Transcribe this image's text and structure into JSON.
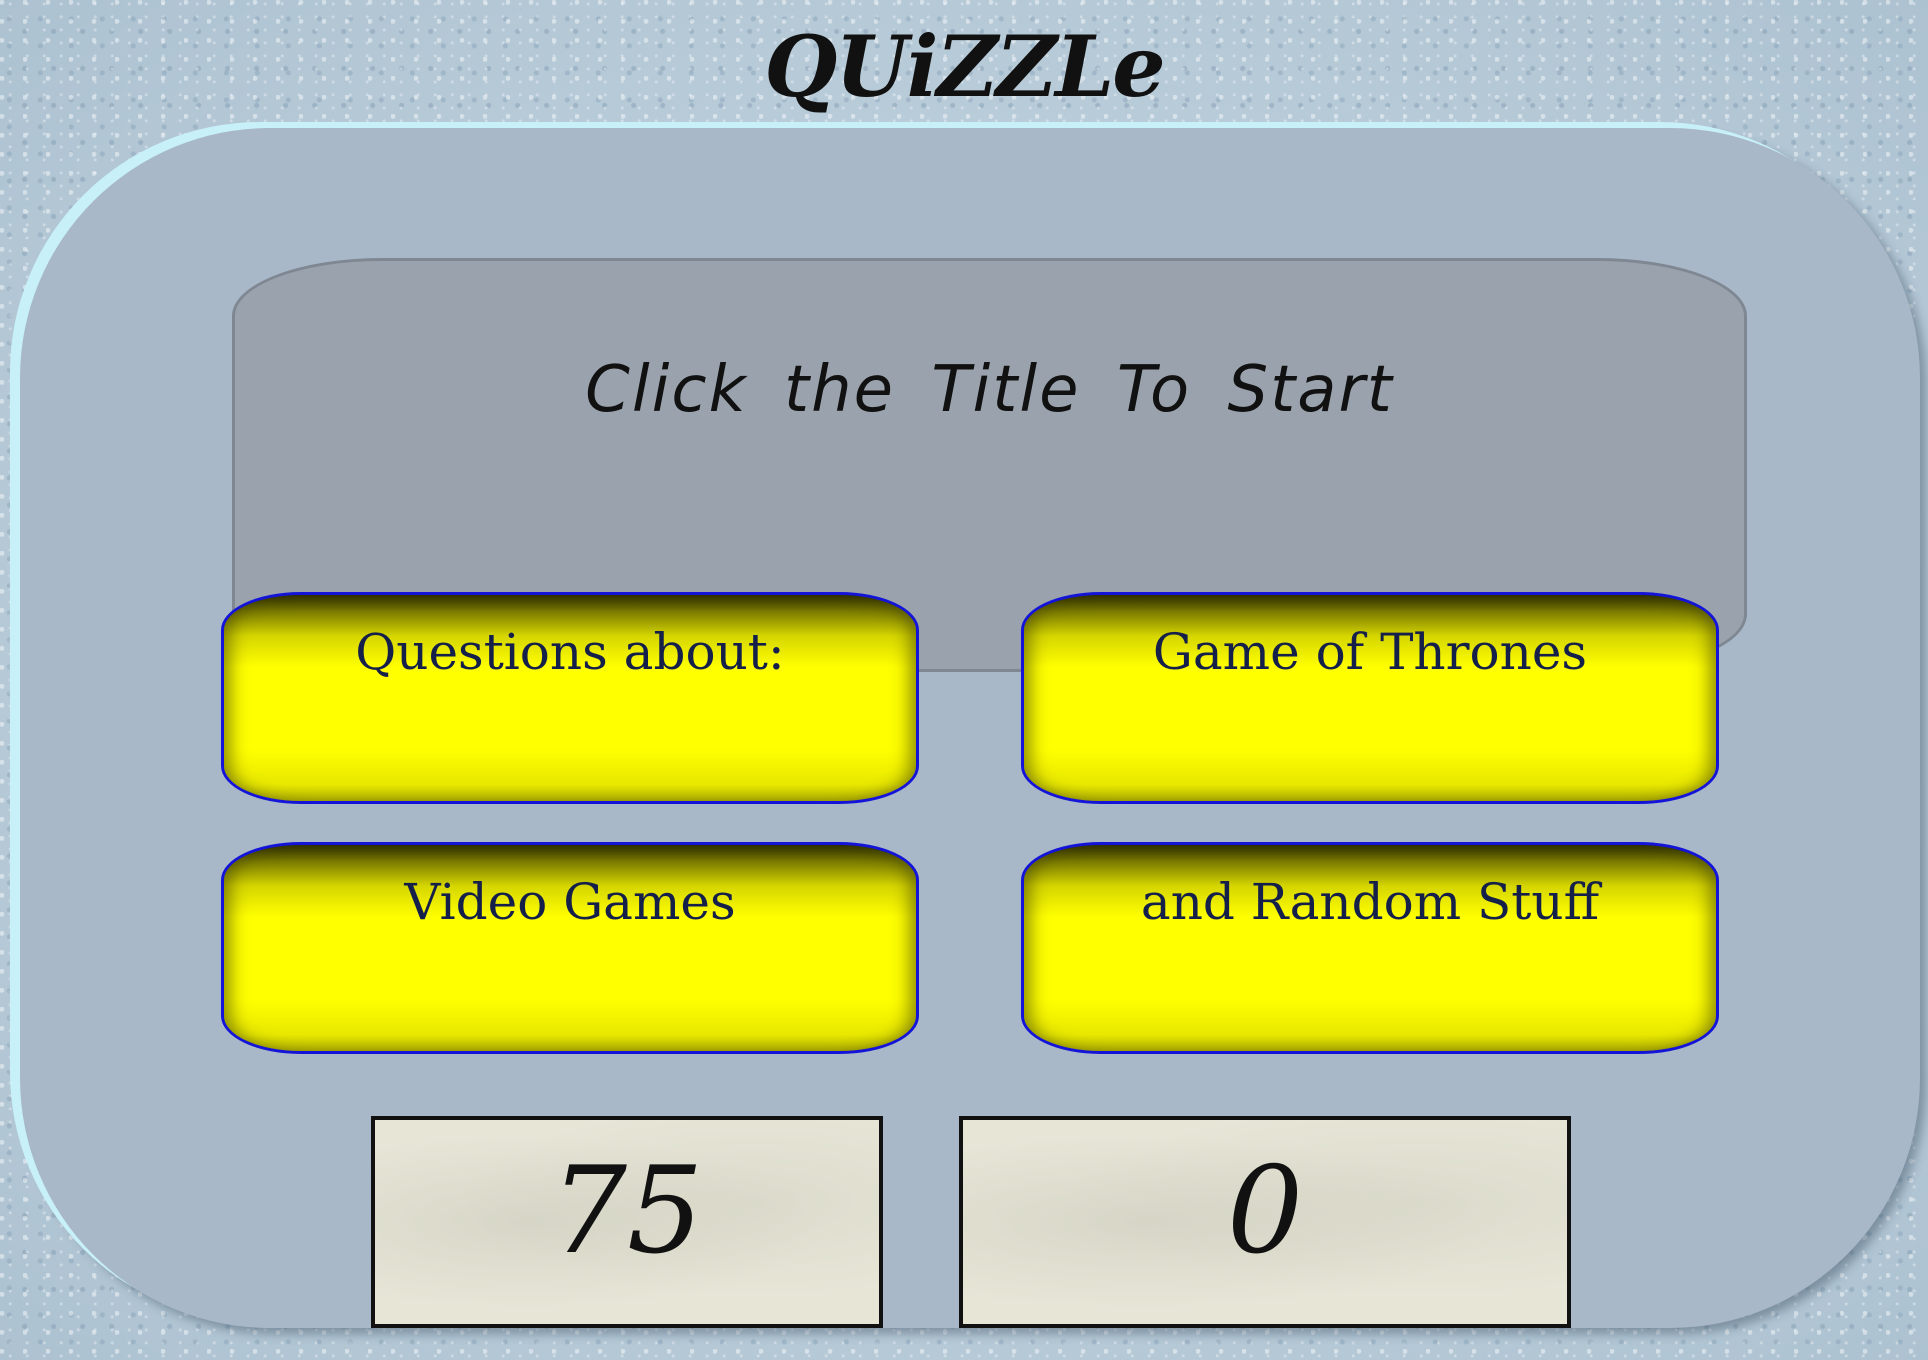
{
  "app": {
    "title": "QUiZZLe"
  },
  "question_panel": {
    "text": "Click the Title To Start"
  },
  "answers": [
    {
      "label": "Questions about:"
    },
    {
      "label": "Game of Thrones"
    },
    {
      "label": "Video Games"
    },
    {
      "label": "and Random Stuff"
    }
  ],
  "scores": {
    "left": "75",
    "right": "0"
  },
  "colors": {
    "button_fill": "#ffff00",
    "button_border": "#1414d8",
    "panel": "#9aa3ad",
    "console": "#a9b8c9",
    "score_box": "#e6e5d6"
  }
}
